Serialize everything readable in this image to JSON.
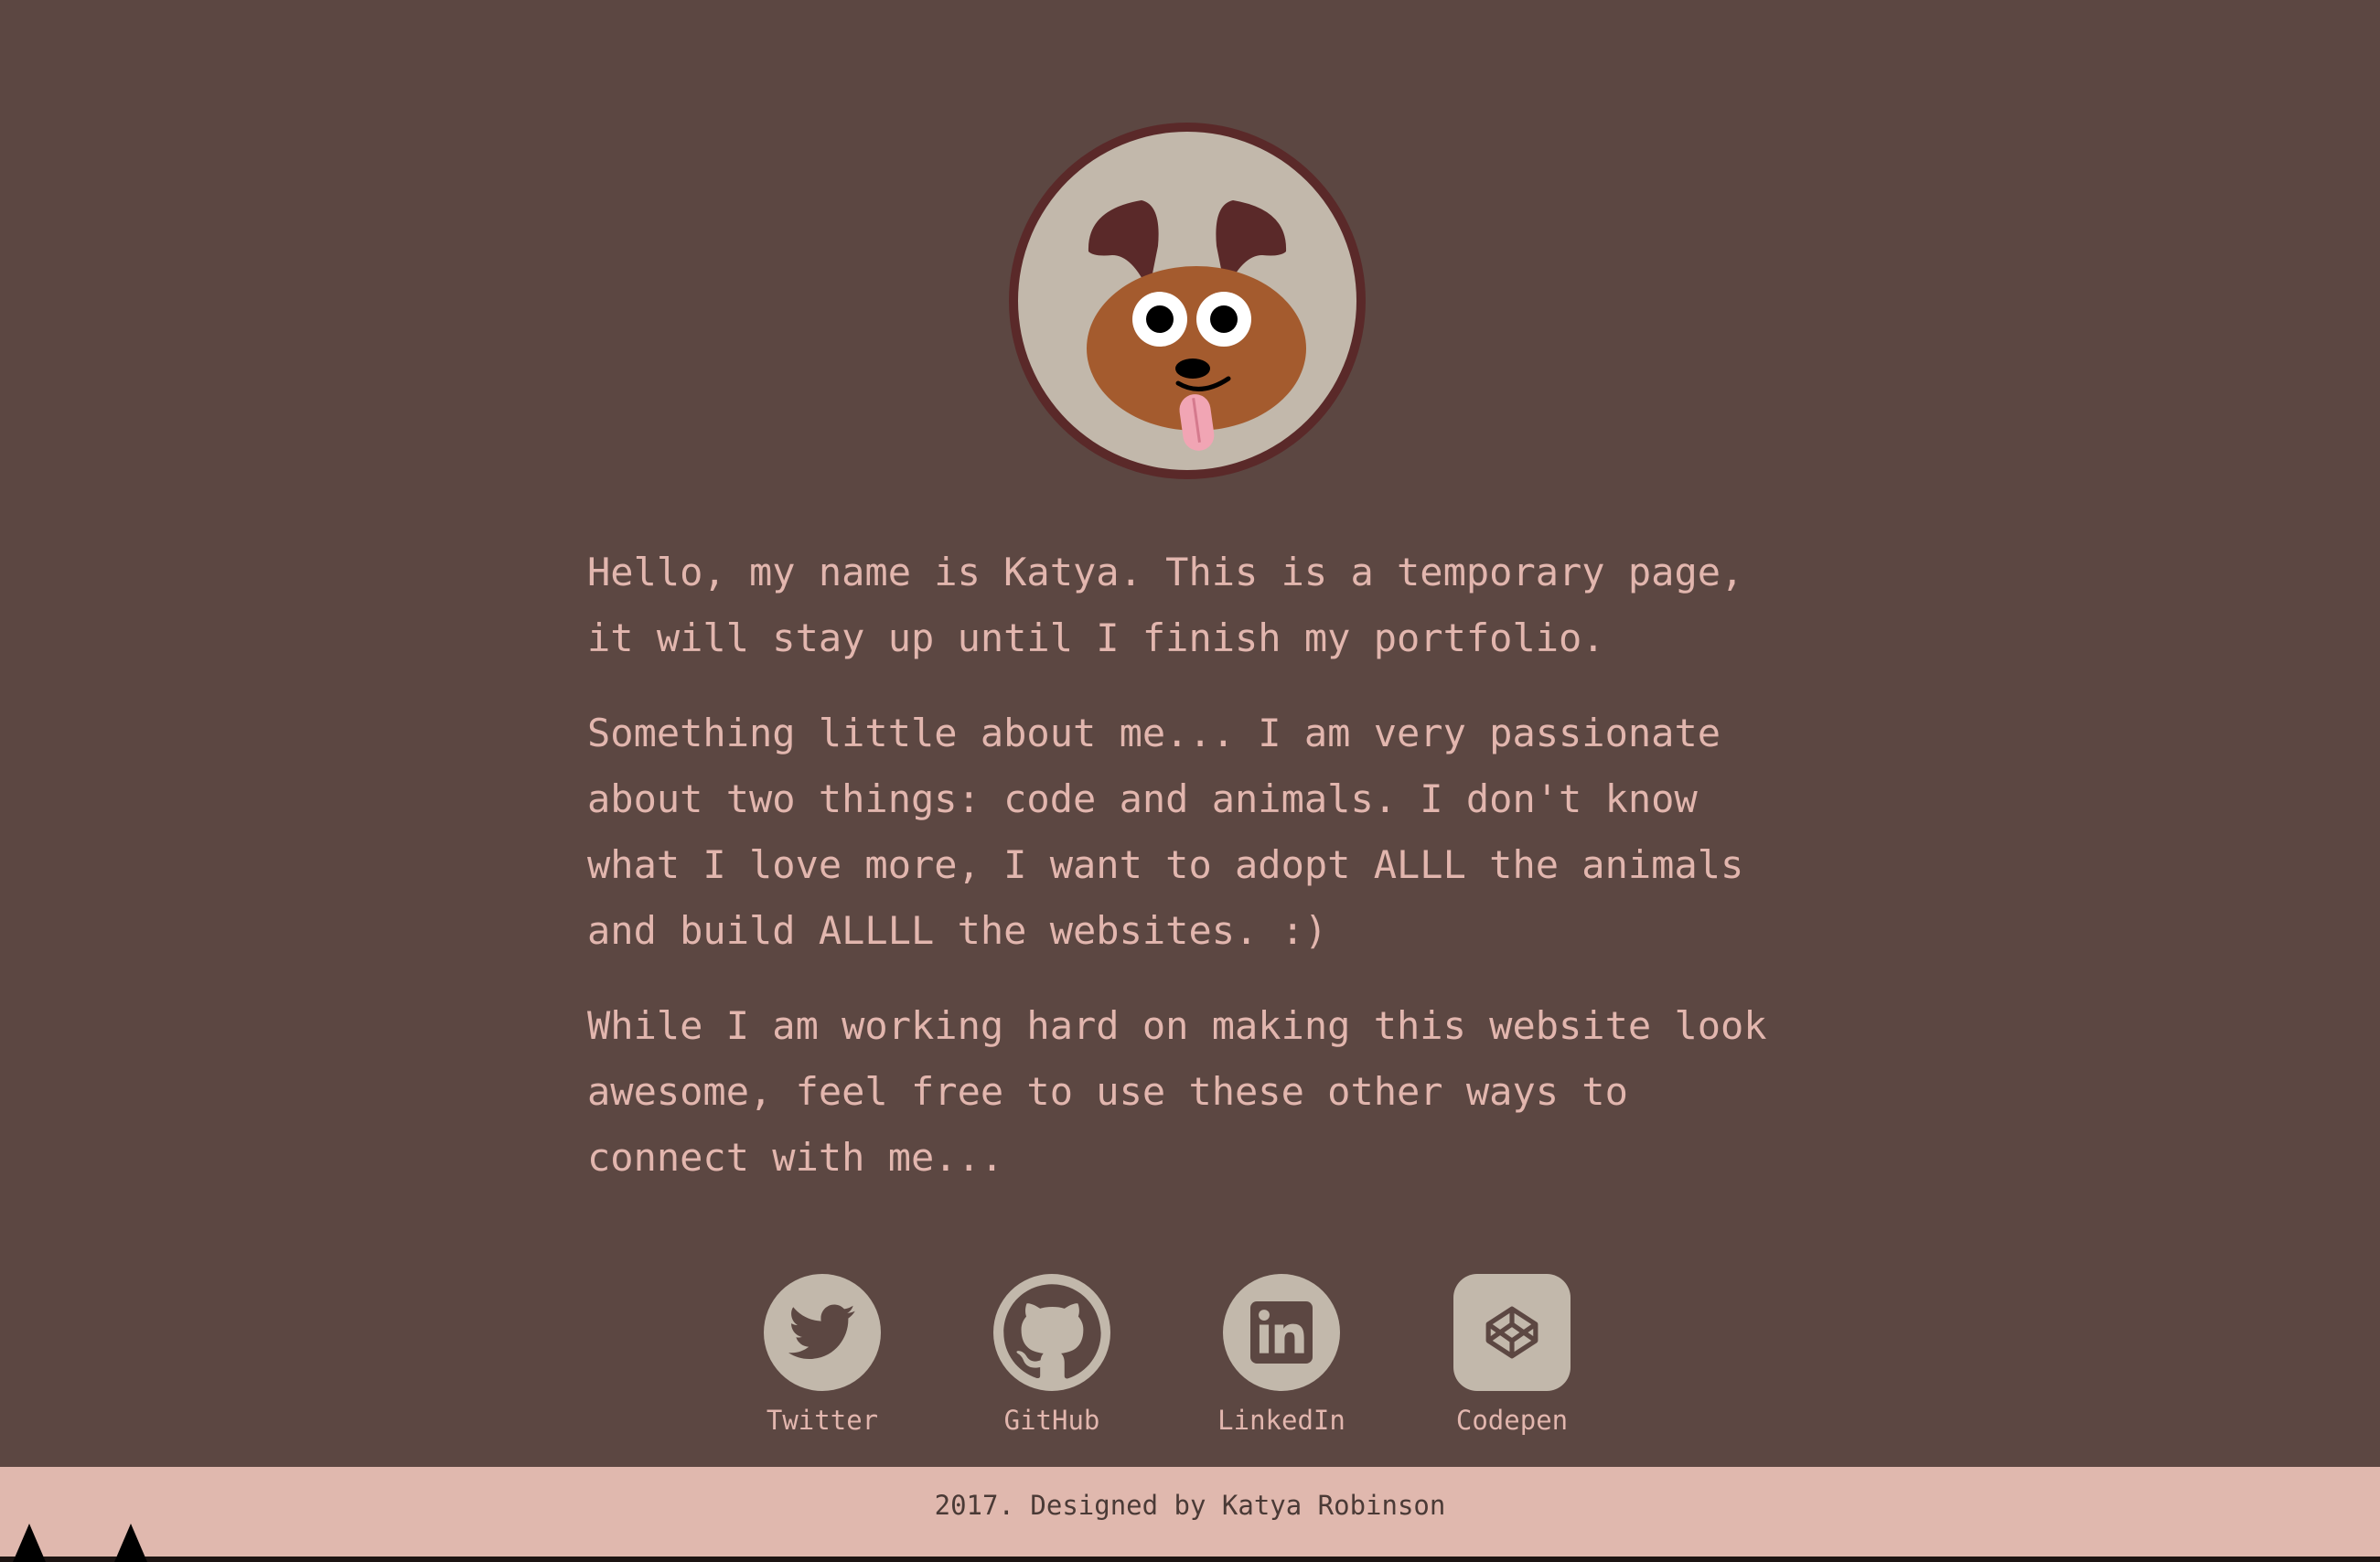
{
  "avatar": {
    "icon": "puppy-icon",
    "colors": {
      "ring": "#5a2929",
      "face_bg": "#c2b8ab",
      "head": "#a45b2e",
      "ears": "#5a2929",
      "tongue": "#f1a5b4"
    }
  },
  "intro": {
    "paragraphs": [
      "Hello, my name is Katya. This is a temporary page, it will stay up until I finish my portfolio.",
      "Something little about me... I am very passionate about two things: code and animals. I don't know what I love more, I want to adopt ALLL the animals and build ALLLL the websites. :)",
      "While I am working hard on making this website look awesome, feel free to use these other ways to connect with me..."
    ]
  },
  "social": {
    "items": [
      {
        "label": "Twitter",
        "icon": "twitter-icon"
      },
      {
        "label": "GitHub",
        "icon": "github-icon"
      },
      {
        "label": "LinkedIn",
        "icon": "linkedin-icon"
      },
      {
        "label": "Codepen",
        "icon": "codepen-icon"
      }
    ]
  },
  "footer": {
    "text": "2017. Designed by Katya Robinson"
  },
  "colors": {
    "background": "#5c4742",
    "text": "#e2b6ae",
    "icon_bg": "#c2b8ab",
    "icon_fg": "#5c4742",
    "footer_bg": "#e0b8ae",
    "footer_text": "#4a3a36"
  }
}
